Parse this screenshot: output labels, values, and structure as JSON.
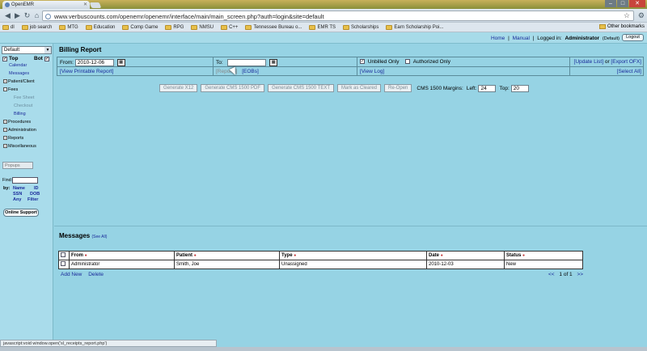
{
  "browser": {
    "tab_title": "OpenEMR",
    "url": "www.verbuscounts.com/openemr/openemr/interface/main/main_screen.php?auth=login&site=default",
    "bookmarks": [
      "dl",
      "job search",
      "MTG",
      "Education",
      "Comp Game",
      "RPG",
      "NMSU",
      "C++",
      "Tennessee Bureau o...",
      "EMR TS",
      "Scholarships",
      "Earn Scholarship Poi..."
    ],
    "other_bookmarks": "Other bookmarks",
    "status_text": "javascript:void window.open('sl_receipts_report.php')"
  },
  "header": {
    "home": "Home",
    "sep": "|",
    "manual": "Manual",
    "logged_in": "Logged in:",
    "user": "Administrator",
    "facility": "(Default)",
    "logout": "Logout"
  },
  "leftnav": {
    "select_value": "Default",
    "top_label": "Top",
    "bot_label": "Bot",
    "items": {
      "calendar": "Calendar",
      "messages": "Messages",
      "patient_client": "Patient/Client",
      "fees": "Fees",
      "fee_sheet": "Fee Sheet",
      "checkout": "Checkout",
      "billing": "Billing",
      "procedures": "Procedures",
      "administration": "Administration",
      "reports": "Reports",
      "miscellaneous": "Miscellaneous"
    },
    "popups": "Popups",
    "find": "Find:",
    "by": "by:",
    "by_name": "Name",
    "by_id": "ID",
    "by_ssn": "SSN",
    "by_dob": "DOB",
    "by_any": "Any",
    "by_filter": "Filter",
    "online_support": "Online Support"
  },
  "billing": {
    "title": "Billing Report",
    "from_label": "From:",
    "from_value": "2010-12-06",
    "to_label": "To:",
    "to_value": "",
    "unbilled_only": "Unbilled Only",
    "authorized_only": "Authorized Only",
    "update_list": "[Update List]",
    "or": "or",
    "export_ofx": "[Export OFX]",
    "view_printable": "[View Printable Report]",
    "reports_link": "[Reports]",
    "eobs": "[EOBs]",
    "view_log": "[View Log]",
    "select_all": "[Select All]",
    "buttons": [
      "Generate X12",
      "Generate CMS 1500 PDF",
      "Generate CMS 1500 TEXT",
      "Mark as Cleared",
      "Re-Open"
    ],
    "margins_label": "CMS 1500 Margins:",
    "left_label": "Left:",
    "left_value": "24",
    "top_label": "Top:",
    "top_value": "20"
  },
  "messages": {
    "title": "Messages",
    "see_all": "(See All)",
    "columns": [
      "From",
      "Patient",
      "Type",
      "Date",
      "Status"
    ],
    "rows": [
      {
        "from": "Administrator",
        "patient": "Smith, Joe",
        "type": "Unassigned",
        "date": "2010-12-03",
        "status": "New"
      }
    ],
    "add_new": "Add New",
    "delete": "Delete",
    "pager_prev": "<<",
    "pager_text": "1 of 1",
    "pager_next": ">>"
  }
}
